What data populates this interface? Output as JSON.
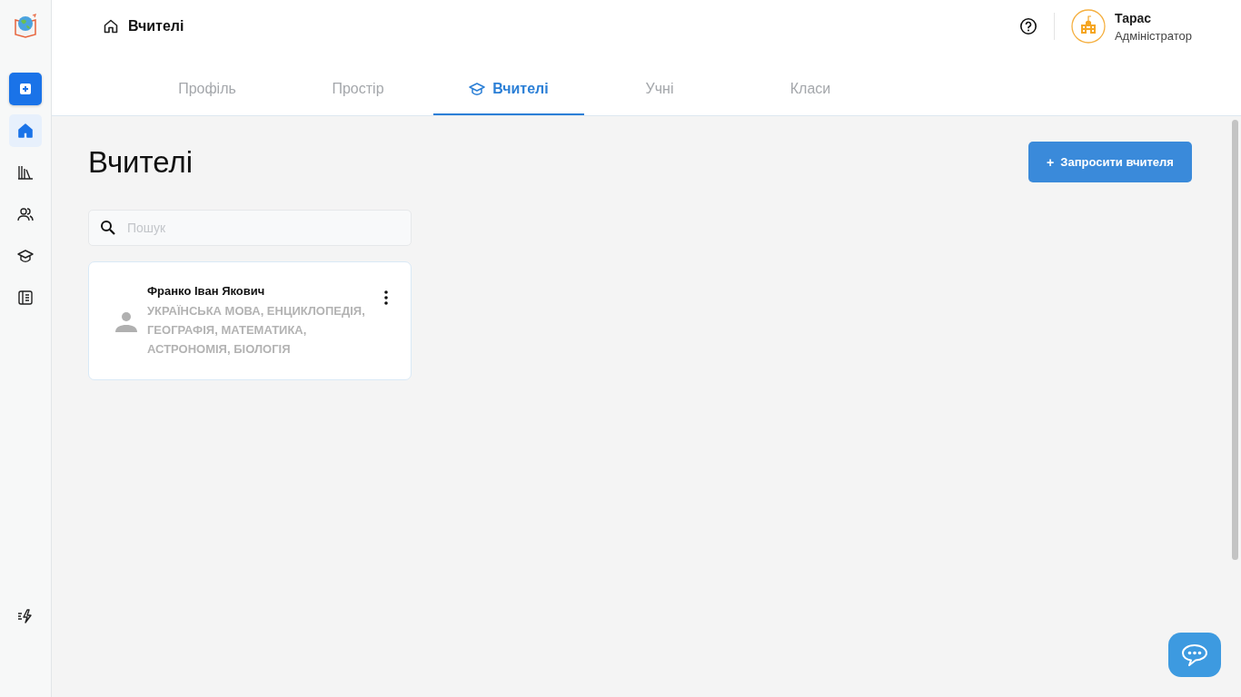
{
  "sidebar": {
    "items": [
      {
        "kind": "add",
        "selected": false
      },
      {
        "kind": "home",
        "selected": true
      },
      {
        "kind": "library",
        "selected": false
      },
      {
        "kind": "people",
        "selected": false
      },
      {
        "kind": "cap",
        "selected": false
      },
      {
        "kind": "journal",
        "selected": false
      }
    ]
  },
  "breadcrumb": "Вчителі",
  "user": {
    "name": "Тарас",
    "role": "Адміністратор"
  },
  "tabs": [
    {
      "label": "Профіль",
      "selected": false
    },
    {
      "label": "Простір",
      "selected": false
    },
    {
      "label": "Вчителі",
      "selected": true
    },
    {
      "label": "Учні",
      "selected": false
    },
    {
      "label": "Класи",
      "selected": false
    }
  ],
  "page_title": "Вчителі",
  "invite_button": {
    "icon": "+",
    "label": "Запросити вчителя"
  },
  "search": {
    "placeholder": "Пошук"
  },
  "teachers": [
    {
      "name": "Франко Іван Якович",
      "subjects": "УКРАЇНСЬКА МОВА, ЕНЦИКЛОПЕДІЯ, ГЕОГРАФІЯ, МАТЕМАТИКА, АСТРОНОМІЯ, БІОЛОГІЯ"
    }
  ]
}
